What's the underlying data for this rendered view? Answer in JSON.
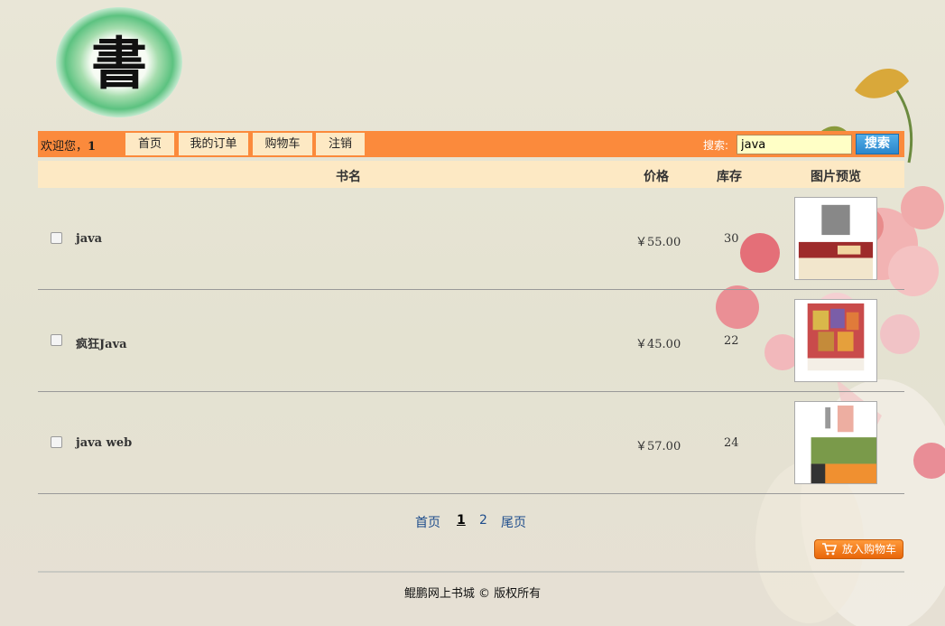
{
  "header": {
    "logo_char": "書"
  },
  "navbar": {
    "welcome_prefix": "欢迎您，",
    "username": "1",
    "links": [
      "首页",
      "我的订单",
      "购物车",
      "注销"
    ],
    "search_label": "搜索:",
    "search_value": "java",
    "search_button": "搜索"
  },
  "table": {
    "headers": {
      "name": "书名",
      "price": "价格",
      "stock": "库存",
      "preview": "图片预览"
    },
    "rows": [
      {
        "name": "java",
        "price": "￥55.00",
        "stock": "30"
      },
      {
        "name": "疯狂Java",
        "price": "￥45.00",
        "stock": "22"
      },
      {
        "name": "java web",
        "price": "￥57.00",
        "stock": "24"
      }
    ]
  },
  "pager": {
    "first": "首页",
    "pages": [
      "1",
      "2"
    ],
    "current": "1",
    "last": "尾页"
  },
  "actions": {
    "add_to_cart": "放入购物车"
  },
  "footer": {
    "text": "鲲鹏网上书城 © 版权所有"
  },
  "colors": {
    "navbar": "#fb8a3c",
    "header_row": "#fde9c4",
    "search_button": "#2a86cc",
    "cart_button": "#e8660a"
  }
}
